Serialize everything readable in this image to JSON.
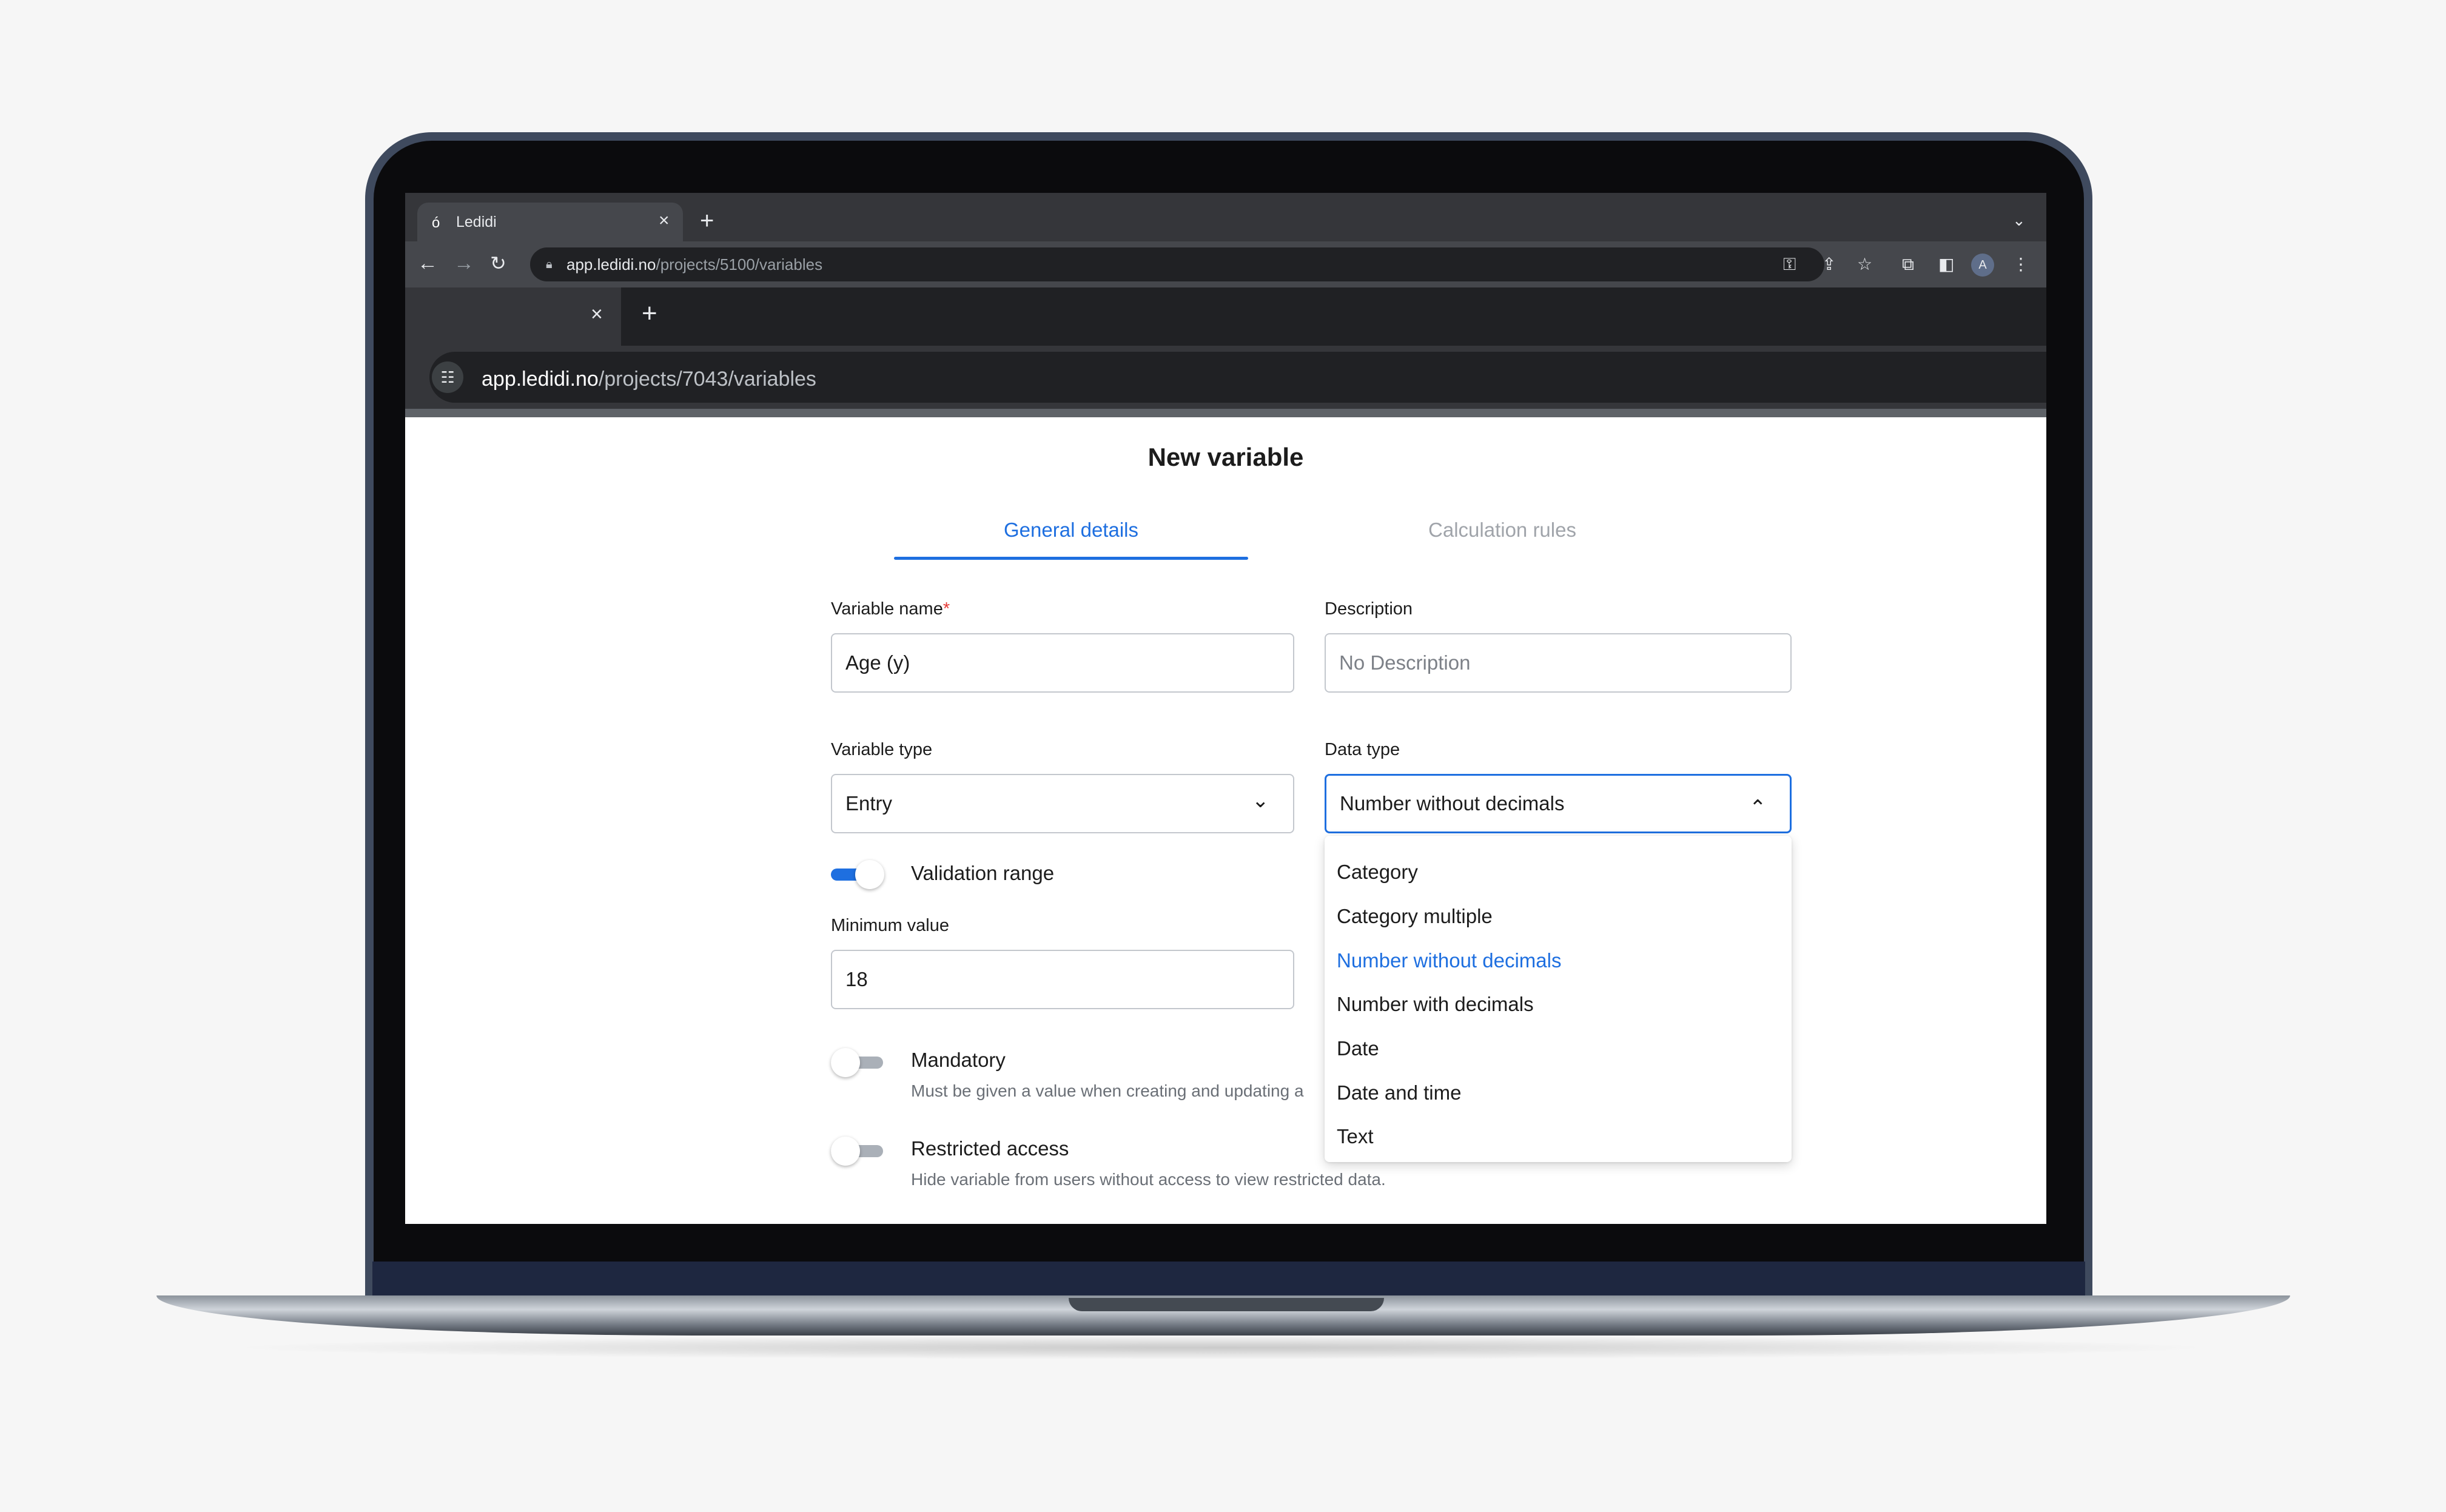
{
  "browser_outer": {
    "tab_title": "Ledidi",
    "url_host": "app.ledidi.no",
    "url_path": "/projects/5100/variables",
    "avatar_initial": "A"
  },
  "browser_inner": {
    "url_host": "app.ledidi.no",
    "url_path": "/projects/7043/variables"
  },
  "page": {
    "title": "New variable"
  },
  "tabs": [
    {
      "label": "General details",
      "active": true
    },
    {
      "label": "Calculation rules",
      "active": false
    }
  ],
  "form": {
    "variable_name": {
      "label": "Variable name",
      "required_mark": "*",
      "value": "Age (y)"
    },
    "description": {
      "label": "Description",
      "placeholder": "No Description"
    },
    "variable_type": {
      "label": "Variable type",
      "value": "Entry"
    },
    "data_type": {
      "label": "Data type",
      "value": "Number without decimals",
      "open": true,
      "options": [
        "Category",
        "Category multiple",
        "Number without decimals",
        "Number with decimals",
        "Date",
        "Date and time",
        "Text"
      ],
      "selected_index": 2
    },
    "validation_range": {
      "label": "Validation range",
      "enabled": true
    },
    "minimum_value": {
      "label": "Minimum value",
      "value": "18"
    },
    "mandatory": {
      "label": "Mandatory",
      "enabled": false,
      "description": "Must be given a value when creating and updating a"
    },
    "restricted_access": {
      "label": "Restricted access",
      "enabled": false,
      "description": "Hide variable from users without access to view restricted data."
    }
  },
  "colors": {
    "accent": "#1e6fe0",
    "required": "#e53935",
    "inactive_tab": "#a0a4aa",
    "toggle_off": "#aab0b8"
  },
  "icons": {
    "close": "×",
    "plus": "+",
    "chevron_down": "⌄",
    "chevron_up": "⌃"
  }
}
